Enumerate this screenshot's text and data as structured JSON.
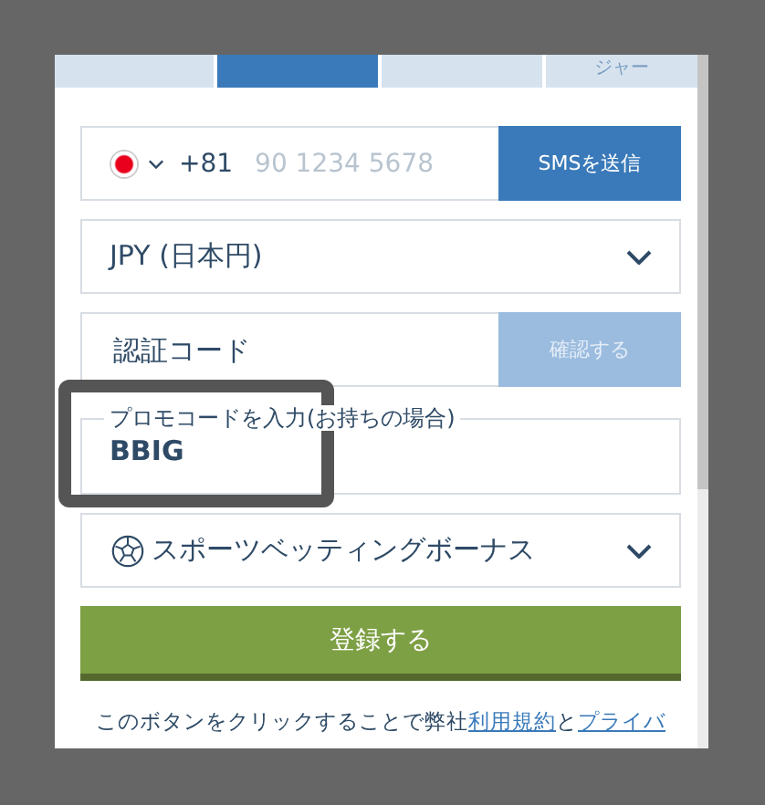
{
  "tabs": [
    {
      "selected": false
    },
    {
      "selected": true
    },
    {
      "selected": false
    },
    {
      "label": "ジャー",
      "selected": false
    }
  ],
  "phone": {
    "country_code": "+81",
    "placeholder": "90 1234 5678",
    "button": "SMSを送信"
  },
  "currency": {
    "value": "JPY (日本円)"
  },
  "verification": {
    "placeholder": "認証コード",
    "button": "確認する",
    "disabled": true
  },
  "promo": {
    "label": "プロモコードを入力(お持ちの場合)",
    "value": "BBIG",
    "highlighted": true
  },
  "bonus": {
    "value": "スポーツベッティングボーナス"
  },
  "register_button": "登録する",
  "terms": {
    "before": "このボタンをクリックすることで弊社",
    "link_1": "利用規約",
    "middle": "と",
    "link_2": "プライバ"
  }
}
